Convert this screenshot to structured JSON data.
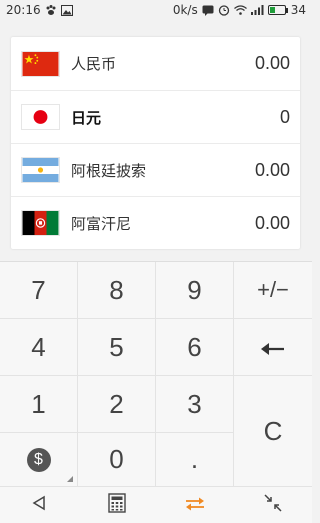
{
  "status_bar": {
    "time": "20:16",
    "network_speed": "0k/s",
    "battery_level": "34",
    "battery_fraction": 0.34,
    "battery_color": "#1f9d3a"
  },
  "currencies": [
    {
      "name": "人民币",
      "value": "0.00",
      "flag": "china-flag-icon",
      "active": false
    },
    {
      "name": "日元",
      "value": "0",
      "flag": "japan-flag-icon",
      "active": true
    },
    {
      "name": "阿根廷披索",
      "value": "0.00",
      "flag": "argentina-flag-icon",
      "active": false
    },
    {
      "name": "阿富汗尼",
      "value": "0.00",
      "flag": "afghanistan-flag-icon",
      "active": false
    }
  ],
  "keypad": {
    "k7": "7",
    "k8": "8",
    "k9": "9",
    "plusminus": "+/−",
    "k4": "4",
    "k5": "5",
    "k6": "6",
    "k1": "1",
    "k2": "2",
    "k3": "3",
    "clear": "C",
    "currency": "$",
    "k0": "0",
    "dot": "."
  },
  "nav": {
    "accent_color": "#f08a24"
  }
}
